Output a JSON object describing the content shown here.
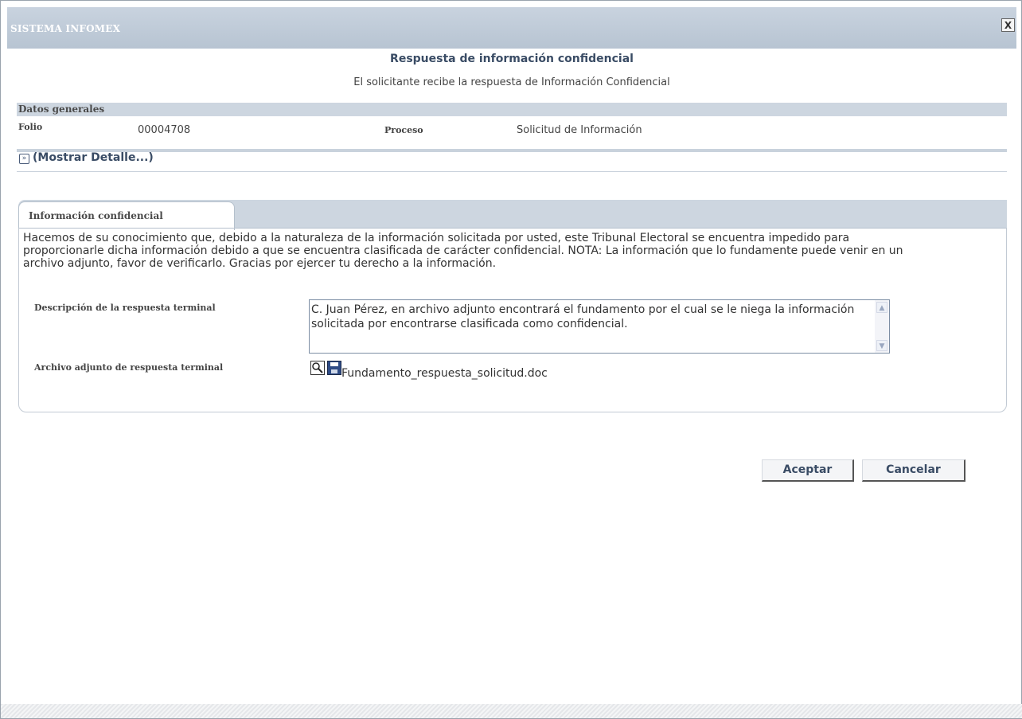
{
  "window": {
    "title": "SISTEMA INFOMEX",
    "close_label": "X"
  },
  "header": {
    "title": "Respuesta de información confidencial",
    "subtitle": "El solicitante recibe la respuesta de Información Confidencial"
  },
  "general": {
    "section_label": "Datos generales",
    "folio_label": "Folio",
    "folio_value": "00004708",
    "proceso_label": "Proceso",
    "proceso_value": "Solicitud de Información"
  },
  "detail": {
    "toggle_label": "(Mostrar Detalle...)"
  },
  "tab": {
    "label": "Información confidencial"
  },
  "content": {
    "notice": "Hacemos de su conocimiento que, debido a la naturaleza de la información solicitada por usted, este Tribunal Electoral se encuentra impedido para proporcionarle dicha información debido a que se encuentra clasificada de carácter confidencial. NOTA: La información que lo fundamente puede venir en un archivo adjunto, favor de verificarlo. Gracias por ejercer tu derecho a la información.",
    "description_label": "Descripción de la respuesta terminal",
    "description_value": "C. Juan Pérez, en archivo adjunto encontrará el fundamento por el cual se le niega la información solicitada por encontrarse clasificada como confidencial.",
    "attachment_label": "Archivo adjunto de respuesta terminal",
    "attachment_name": "Fundamento_respuesta_solicitud.doc"
  },
  "actions": {
    "accept": "Aceptar",
    "cancel": "Cancelar"
  }
}
